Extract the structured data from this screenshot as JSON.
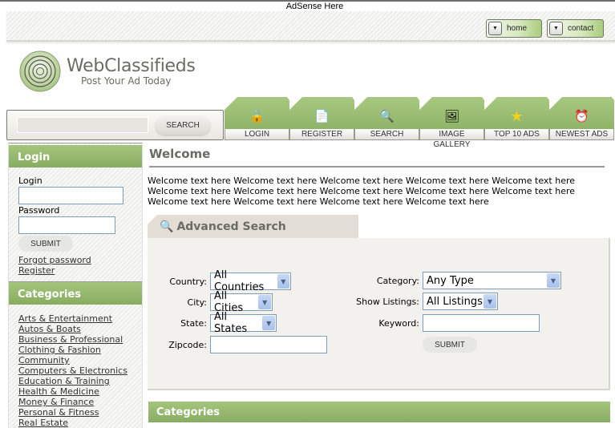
{
  "adsense": "AdSense Here",
  "top_nav": [
    {
      "label": "home",
      "icon": "chevron-down-icon"
    },
    {
      "label": "contact",
      "icon": "chevron-down-icon"
    }
  ],
  "brand": {
    "name": "WebClassifieds",
    "tagline": "Post Your Ad Today",
    "accent": "#8fb468"
  },
  "search": {
    "placeholder": "",
    "value": "",
    "button": "SEARCH"
  },
  "tabs": [
    {
      "label": "LOGIN",
      "icon": "padlock-icon",
      "glyph": "🔒"
    },
    {
      "label": "REGISTER",
      "icon": "document-icon",
      "glyph": "📄"
    },
    {
      "label": "SEARCH",
      "icon": "magnifier-icon",
      "glyph": "🔍"
    },
    {
      "label": "IMAGE GALLERY",
      "icon": "picture-icon",
      "glyph": "🖼"
    },
    {
      "label": "TOP 10 ADS",
      "icon": "star-icon",
      "glyph": "★"
    },
    {
      "label": "NEWEST ADS",
      "icon": "alarm-clock-icon",
      "glyph": "⏰"
    }
  ],
  "login": {
    "title": "Login",
    "login_label": "Login",
    "login_value": "",
    "password_label": "Password",
    "password_value": "",
    "submit": "SUBMIT",
    "forgot": "Forgot password",
    "register": "Register"
  },
  "categories": {
    "title": "Categories",
    "items": [
      "Arts & Entertainment",
      "Autos & Boats",
      "Business & Professional",
      "Clothing & Fashion",
      "Community",
      "Computers & Electronics",
      "Education & Training",
      "Health & Medicine",
      "Money & Finance",
      "Personal & Fitness",
      "Real Estate"
    ]
  },
  "welcome": {
    "title": "Welcome",
    "text": "Welcome text here Welcome text here Welcome text here Welcome text here Welcome text here Welcome text here Welcome text here Welcome text here Welcome text here Welcome text here Welcome text here Welcome text here Welcome text here Welcome text here"
  },
  "advanced_search": {
    "title": "Advanced Search",
    "country": {
      "label": "Country:",
      "value": "All Countries"
    },
    "city": {
      "label": "City:",
      "value": "All Cities"
    },
    "state": {
      "label": "State:",
      "value": "All States"
    },
    "zipcode": {
      "label": "Zipcode:",
      "value": ""
    },
    "category": {
      "label": "Category:",
      "value": "Any Type"
    },
    "show_listings": {
      "label": "Show Listings:",
      "value": "All Listings"
    },
    "keyword": {
      "label": "Keyword:",
      "value": ""
    },
    "submit": "SUBMIT"
  },
  "categories_bar": {
    "title": "Categories"
  }
}
